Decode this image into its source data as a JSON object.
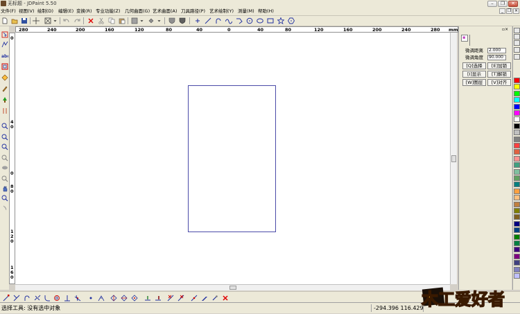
{
  "window": {
    "title": "无标题 - JDPaint 5.50",
    "minimize": "–",
    "restore": "❐",
    "close": "✕"
  },
  "menu": [
    "文件(F)",
    "视图(V)",
    "绘制(D)",
    "编辑(E)",
    "变换(R)",
    "专业功能(Z)",
    "几何曲面(G)",
    "艺术曲面(A)",
    "刀具路径(P)",
    "艺术绘制(Y)",
    "测量(M)",
    "帮助(H)"
  ],
  "mdi_controls": [
    "_",
    "❐",
    "×"
  ],
  "toolbar_icons": [
    "new-file-icon",
    "open-file-icon",
    "save-icon",
    "crosshair-icon",
    "select-box-icon",
    "dropdown-icon",
    "undo-icon",
    "redo-icon",
    "delete-icon",
    "cut-icon",
    "copy-icon",
    "paste-icon",
    "layer-icon",
    "color-fill-icon",
    "dropdown-icon",
    "shade-icon",
    "dropdown-icon",
    "shield-icon",
    "shield-icon",
    "point-icon",
    "line-icon",
    "arc-icon",
    "spline-icon",
    "polyline-icon",
    "circle-icon",
    "ellipse-icon",
    "rectangle-icon",
    "star-icon",
    "polygon-icon"
  ],
  "ruler": {
    "unit": "mm",
    "h_labels": [
      "280",
      "240",
      "200",
      "160",
      "120",
      "80",
      "40",
      "0",
      "40",
      "80",
      "120",
      "160",
      "200",
      "240",
      "280"
    ],
    "v_labels": [
      "0",
      "4",
      "0",
      "0",
      "8",
      "0",
      "1",
      "2",
      "0",
      "1",
      "6",
      "0"
    ]
  },
  "panel": {
    "field1_label": "微调距离",
    "field1_value": "2.000",
    "field2_label": "微调角度",
    "field2_value": "90.000",
    "buttons": [
      "[Q]选择",
      "[E]加锁",
      "[I]显示",
      "[T]解锁",
      "[W]图层",
      "[V]对齐"
    ]
  },
  "palette": [
    "#ff0000",
    "#ffff00",
    "#00ff00",
    "#00ffff",
    "#0000ff",
    "#ff00ff",
    "#ffffff",
    "#000000",
    "#c0c0c0",
    "#808080",
    "#ff4040",
    "#e06040",
    "#ff9090",
    "#40a080",
    "#80c0a0",
    "#60a060",
    "#008080",
    "#ffa040",
    "#ffc080",
    "#c08040",
    "#808000",
    "#806020",
    "#000080",
    "#004080",
    "#008000",
    "#008040",
    "#400080",
    "#800080",
    "#404080",
    "#8080c0",
    "#c0c0ff"
  ],
  "bottom_icons": [
    "edit-node-icon",
    "trim-icon",
    "extend-icon",
    "break-icon",
    "fillet-icon",
    "offset-icon",
    "perpendicular-icon",
    "tangent-icon",
    "point-node-icon",
    "corner-icon",
    "mirror-icon",
    "array-icon",
    "align-icon",
    "ruler-tool-icon",
    "measure-icon",
    "erase-node-icon",
    "cut-node-icon",
    "join-icon",
    "knife-icon",
    "brush-icon",
    "eraser-icon",
    "cancel-icon"
  ],
  "status": {
    "message": "选择工具: 没有选中对象",
    "coords": "-294.396 116.429"
  },
  "watermark": {
    "text": "木工爱好者"
  }
}
